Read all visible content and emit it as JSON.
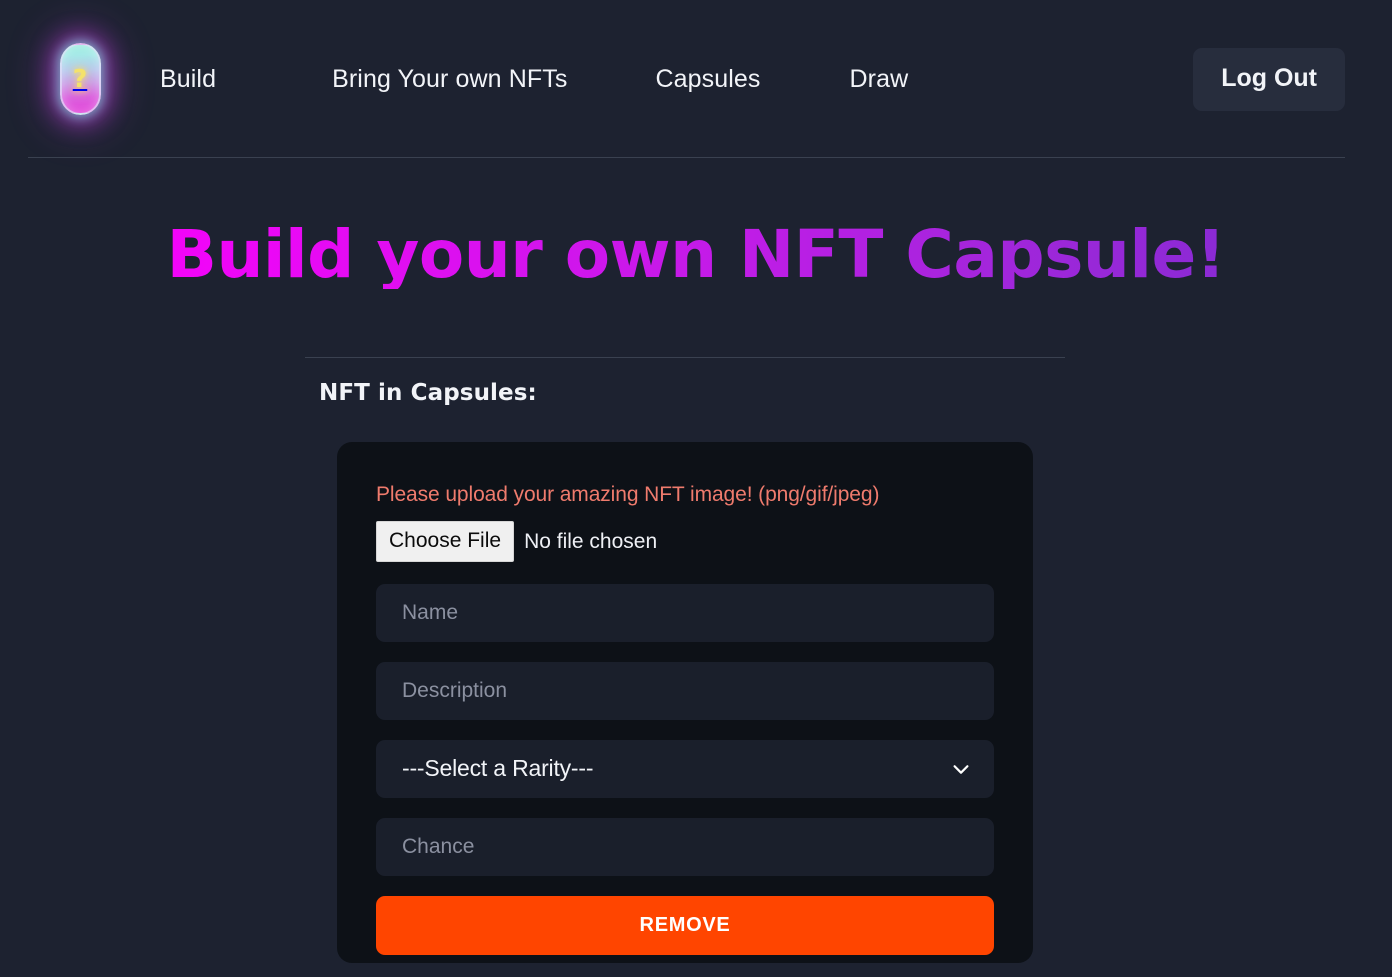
{
  "brand": {
    "logo_icon": "capsule-question-icon",
    "logo_symbol": "?"
  },
  "nav": {
    "items": [
      {
        "label": "Build"
      },
      {
        "label": "Bring Your own NFTs"
      },
      {
        "label": "Capsules"
      },
      {
        "label": "Draw"
      }
    ],
    "logout_label": "Log Out"
  },
  "main": {
    "page_title": "Build your own NFT Capsule!",
    "section_heading": "NFT in Capsules:"
  },
  "nft_form": {
    "upload_label": "Please upload your amazing NFT image! (png/gif/jpeg)",
    "choose_file_label": "Choose File",
    "file_status": "No file chosen",
    "name": {
      "value": "",
      "placeholder": "Name"
    },
    "description": {
      "value": "",
      "placeholder": "Description"
    },
    "rarity": {
      "selected": "---Select a Rarity---",
      "chevron_icon": "chevron-down-icon"
    },
    "chance": {
      "value": "",
      "placeholder": "Chance"
    },
    "remove_label": "REMOVE"
  },
  "colors": {
    "page_background": "#1d2230",
    "card_background": "#0d1117",
    "field_background": "#1a1f2b",
    "title_gradient_start": "#ff00ff",
    "title_gradient_end": "#7c2ecd",
    "upload_label": "#ef7b6d",
    "remove_button": "#ff4500",
    "logout_button": "#272d3d",
    "divider": "#3a4150"
  }
}
